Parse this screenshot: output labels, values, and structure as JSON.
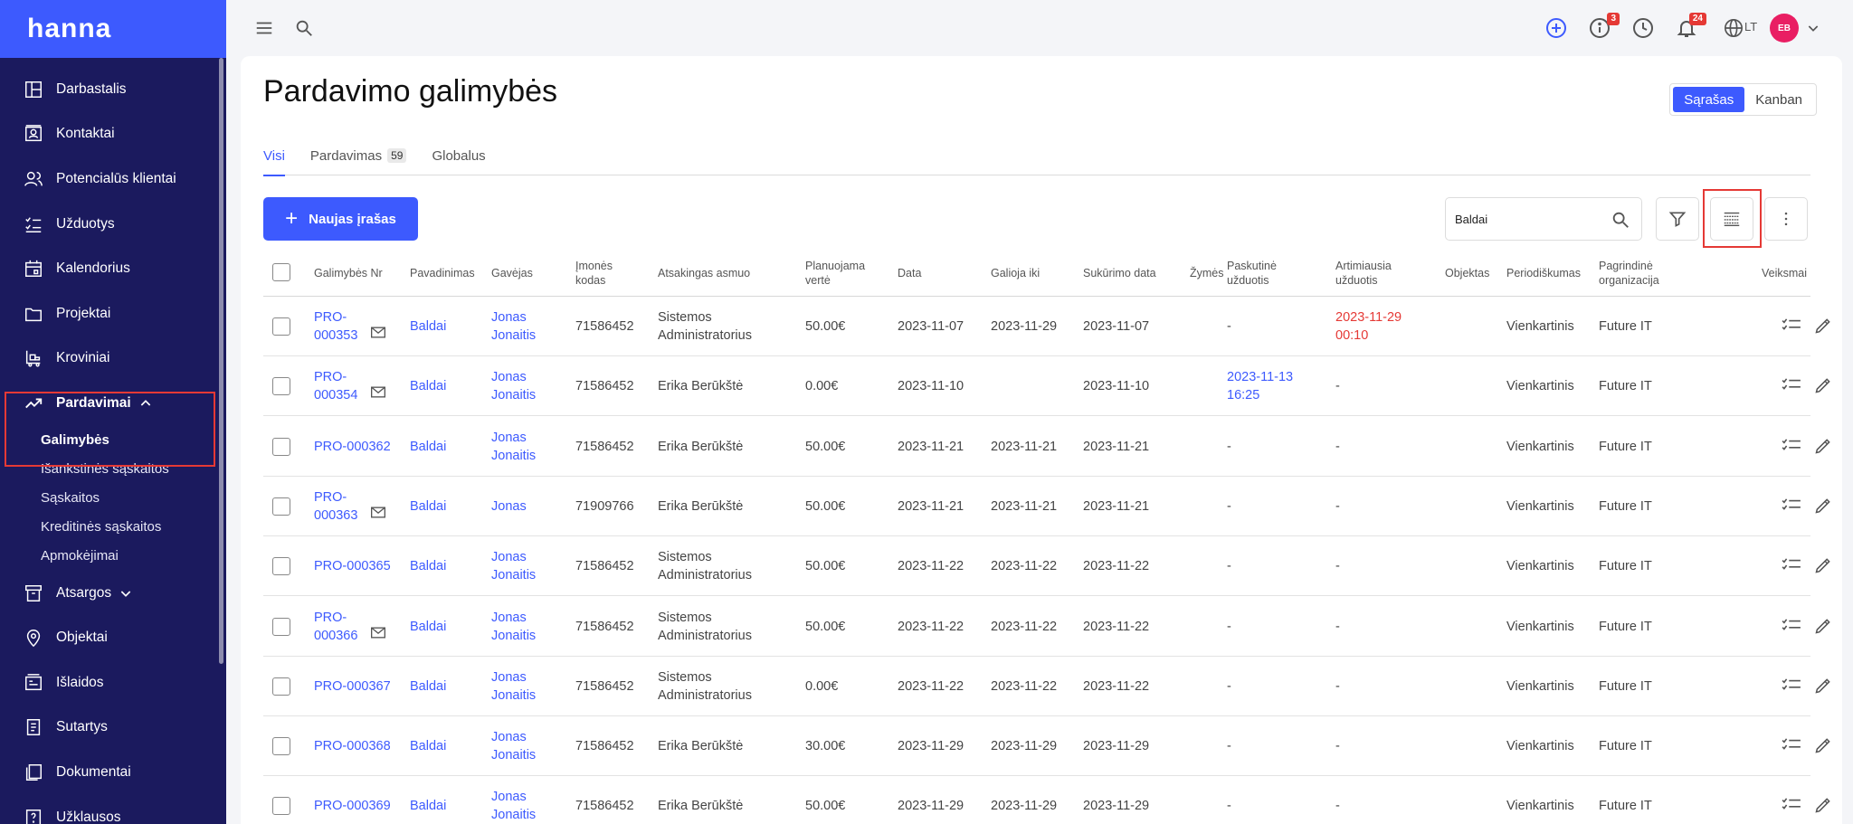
{
  "app": {
    "logo": "hanna"
  },
  "sidebar": {
    "items": [
      {
        "label": "Darbastalis",
        "icon": "dashboard-icon"
      },
      {
        "label": "Kontaktai",
        "icon": "contact-card-icon"
      },
      {
        "label": "Potencialūs klientai",
        "icon": "users-icon"
      },
      {
        "label": "Užduotys",
        "icon": "checklist-icon"
      },
      {
        "label": "Kalendorius",
        "icon": "calendar-icon"
      },
      {
        "label": "Projektai",
        "icon": "folder-icon"
      },
      {
        "label": "Kroviniai",
        "icon": "forklift-icon"
      },
      {
        "label": "Pardavimai",
        "icon": "trending-up-icon"
      }
    ],
    "sub_items": [
      "Galimybės",
      "Išankstinės sąskaitos",
      "Sąskaitos",
      "Kreditinės sąskaitos",
      "Apmokėjimai"
    ],
    "items_after": [
      {
        "label": "Atsargos",
        "icon": "archive-icon"
      },
      {
        "label": "Objektai",
        "icon": "location-pin-icon"
      },
      {
        "label": "Išlaidos",
        "icon": "expenses-icon"
      },
      {
        "label": "Sutartys",
        "icon": "contract-icon"
      },
      {
        "label": "Dokumentai",
        "icon": "documents-icon"
      },
      {
        "label": "Užklausos",
        "icon": "inquiry-icon"
      }
    ]
  },
  "topbar": {
    "info_badge": "3",
    "notif_badge": "24",
    "language": "LT",
    "user_initials": "EB"
  },
  "page": {
    "title": "Pardavimo galimybės",
    "view_list": "Sąrašas",
    "view_kanban": "Kanban",
    "tabs": [
      {
        "label": "Visi",
        "count": ""
      },
      {
        "label": "Pardavimas",
        "count": "59"
      },
      {
        "label": "Globalus",
        "count": ""
      }
    ],
    "new_button": "Naujas įrašas",
    "search_value": "Baldai"
  },
  "table": {
    "headers": {
      "nr": "Galimybės Nr",
      "name": "Pavadinimas",
      "recipient": "Gavėjas",
      "code": "Įmonės kodas",
      "responsible": "Atsakingas asmuo",
      "value": "Planuojama vertė",
      "date": "Data",
      "valid": "Galioja iki",
      "created": "Sukūrimo data",
      "tags": "Žymės",
      "last_task": "Paskutinė užduotis",
      "next_task": "Artimiausia užduotis",
      "object": "Objektas",
      "periodicity": "Periodiškumas",
      "org": "Pagrindinė organizacija",
      "actions": "Veiksmai"
    },
    "rows": [
      {
        "nr": "PRO-000353",
        "mail": true,
        "name": "Baldai",
        "recipient": "Jonas Jonaitis",
        "code": "71586452",
        "responsible": "Sistemos Administratorius",
        "value": "50.00€",
        "date": "2023-11-07",
        "valid": "2023-11-29",
        "created": "2023-11-07",
        "last_task": "-",
        "next_task": "2023-11-29 00:10",
        "next_red": true,
        "periodicity": "Vienkartinis",
        "org": "Future IT"
      },
      {
        "nr": "PRO-000354",
        "mail": true,
        "name": "Baldai",
        "recipient": "Jonas Jonaitis",
        "code": "71586452",
        "responsible": "Erika Berūkštė",
        "value": "0.00€",
        "date": "2023-11-10",
        "valid": "",
        "created": "2023-11-10",
        "last_task": "2023-11-13 16:25",
        "last_link": true,
        "next_task": "-",
        "periodicity": "Vienkartinis",
        "org": "Future IT"
      },
      {
        "nr": "PRO-000362",
        "mail": false,
        "name": "Baldai",
        "recipient": "Jonas Jonaitis",
        "code": "71586452",
        "responsible": "Erika Berūkštė",
        "value": "50.00€",
        "date": "2023-11-21",
        "valid": "2023-11-21",
        "created": "2023-11-21",
        "last_task": "-",
        "next_task": "-",
        "periodicity": "Vienkartinis",
        "org": "Future IT"
      },
      {
        "nr": "PRO-000363",
        "mail": true,
        "name": "Baldai",
        "recipient": "Jonas",
        "code": "71909766",
        "responsible": "Erika Berūkštė",
        "value": "50.00€",
        "date": "2023-11-21",
        "valid": "2023-11-21",
        "created": "2023-11-21",
        "last_task": "-",
        "next_task": "-",
        "periodicity": "Vienkartinis",
        "org": "Future IT"
      },
      {
        "nr": "PRO-000365",
        "mail": false,
        "name": "Baldai",
        "recipient": "Jonas Jonaitis",
        "code": "71586452",
        "responsible": "Sistemos Administratorius",
        "value": "50.00€",
        "date": "2023-11-22",
        "valid": "2023-11-22",
        "created": "2023-11-22",
        "last_task": "-",
        "next_task": "-",
        "periodicity": "Vienkartinis",
        "org": "Future IT"
      },
      {
        "nr": "PRO-000366",
        "mail": true,
        "name": "Baldai",
        "recipient": "Jonas Jonaitis",
        "code": "71586452",
        "responsible": "Sistemos Administratorius",
        "value": "50.00€",
        "date": "2023-11-22",
        "valid": "2023-11-22",
        "created": "2023-11-22",
        "last_task": "-",
        "next_task": "-",
        "periodicity": "Vienkartinis",
        "org": "Future IT"
      },
      {
        "nr": "PRO-000367",
        "mail": false,
        "name": "Baldai",
        "recipient": "Jonas Jonaitis",
        "code": "71586452",
        "responsible": "Sistemos Administratorius",
        "value": "0.00€",
        "date": "2023-11-22",
        "valid": "2023-11-22",
        "created": "2023-11-22",
        "last_task": "-",
        "next_task": "-",
        "periodicity": "Vienkartinis",
        "org": "Future IT"
      },
      {
        "nr": "PRO-000368",
        "mail": false,
        "name": "Baldai",
        "recipient": "Jonas Jonaitis",
        "code": "71586452",
        "responsible": "Erika Berūkštė",
        "value": "30.00€",
        "date": "2023-11-29",
        "valid": "2023-11-29",
        "created": "2023-11-29",
        "last_task": "-",
        "next_task": "-",
        "periodicity": "Vienkartinis",
        "org": "Future IT"
      },
      {
        "nr": "PRO-000369",
        "mail": false,
        "name": "Baldai",
        "recipient": "Jonas Jonaitis",
        "code": "71586452",
        "responsible": "Erika Berūkštė",
        "value": "50.00€",
        "date": "2023-11-29",
        "valid": "2023-11-29",
        "created": "2023-11-29",
        "last_task": "-",
        "next_task": "-",
        "periodicity": "Vienkartinis",
        "org": "Future IT"
      }
    ]
  },
  "colors": {
    "accent": "#3d5afe",
    "sidebar": "#1b1a5e",
    "alert": "#e53935"
  }
}
